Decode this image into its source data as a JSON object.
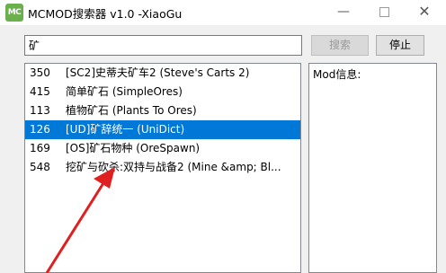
{
  "window": {
    "title": "MCMOD搜索器 v1.0  -XiaoGu",
    "icon_label": "MC",
    "minimize_glyph": "—",
    "close_glyph": "✕"
  },
  "search": {
    "query": "矿",
    "search_label": "搜索",
    "stop_label": "停止"
  },
  "results": [
    {
      "id": "350",
      "name": "[SC2]史蒂夫矿车2 (Steve's Carts 2)"
    },
    {
      "id": "415",
      "name": "简单矿石 (SimpleOres)"
    },
    {
      "id": "113",
      "name": "植物矿石 (Plants To Ores)"
    },
    {
      "id": "126",
      "name": "[UD]矿辞统一 (UniDict)",
      "selected": true
    },
    {
      "id": "169",
      "name": "[OS]矿石物种 (OreSpawn)"
    },
    {
      "id": "548",
      "name": "挖矿与砍杀:双持与战备2 (Mine &amp; Bl..."
    }
  ],
  "info": {
    "label": "Mod信息:"
  },
  "colors": {
    "selection": "#0078d7",
    "arrow": "#e02020",
    "app_icon": "#6ab04c"
  }
}
